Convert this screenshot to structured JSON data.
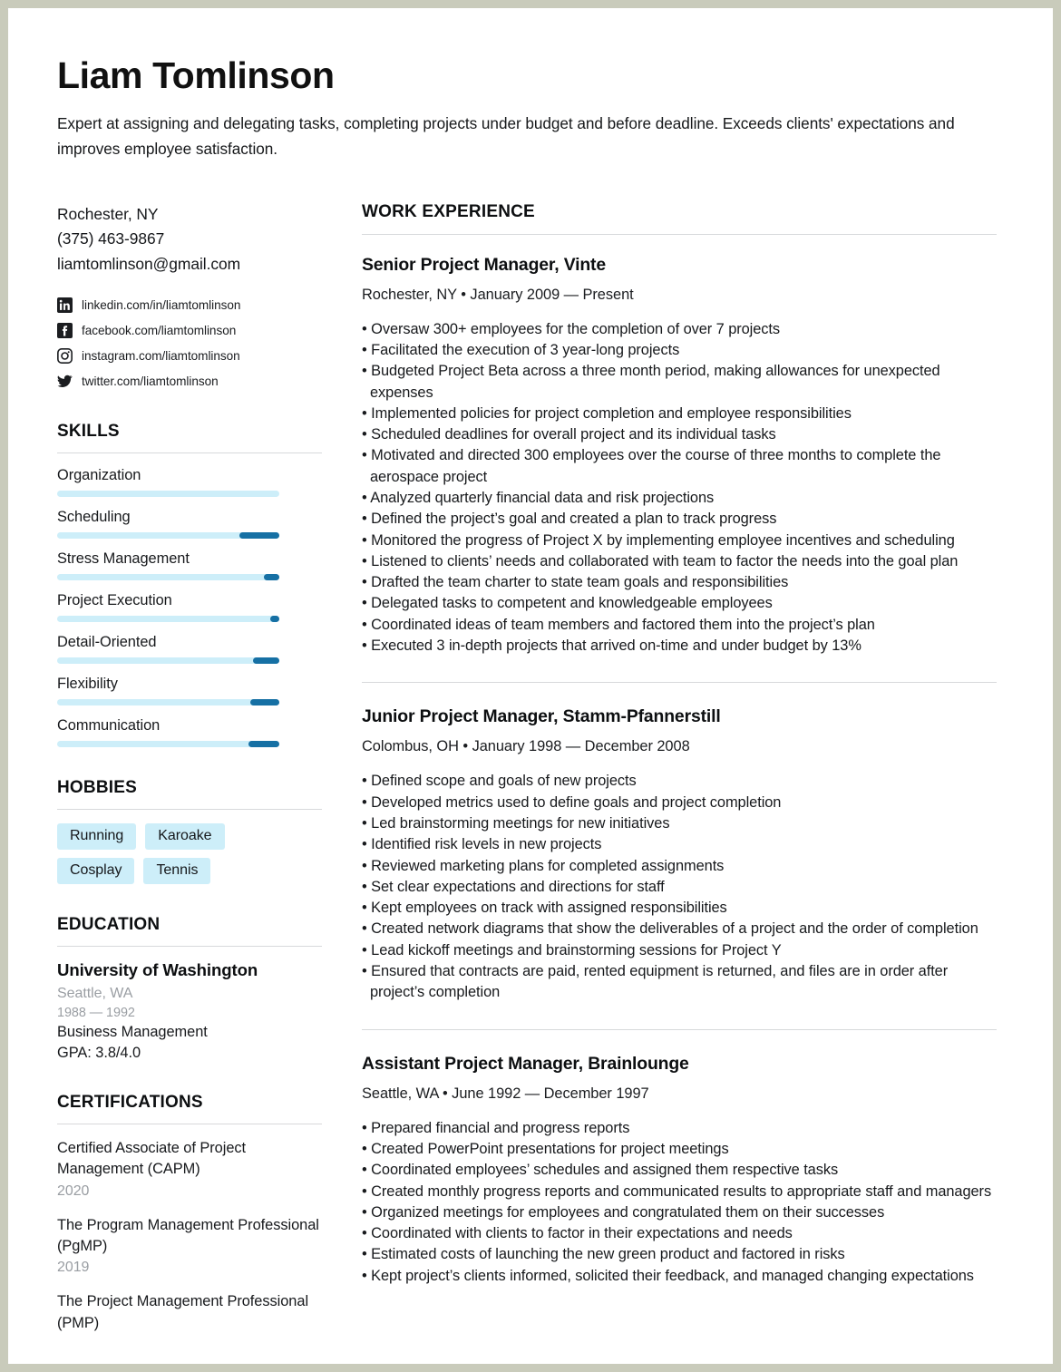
{
  "header": {
    "name": "Liam Tomlinson",
    "summary": "Expert at assigning and delegating tasks, completing projects under budget and before deadline. Exceeds clients' expectations and improves employee satisfaction."
  },
  "contact": {
    "location": "Rochester, NY",
    "phone": "(375) 463-9867",
    "email": "liamtomlinson@gmail.com",
    "social": [
      {
        "icon": "linkedin-icon",
        "text": "linkedin.com/in/liamtomlinson"
      },
      {
        "icon": "facebook-icon",
        "text": "facebook.com/liamtomlinson"
      },
      {
        "icon": "instagram-icon",
        "text": "instagram.com/liamtomlinson"
      },
      {
        "icon": "twitter-icon",
        "text": "twitter.com/liamtomlinson"
      }
    ]
  },
  "skills": {
    "heading": "SKILLS",
    "items": [
      {
        "name": "Organization",
        "fill_pct": 0
      },
      {
        "name": "Scheduling",
        "fill_pct": 18
      },
      {
        "name": "Stress Management",
        "fill_pct": 7
      },
      {
        "name": "Project Execution",
        "fill_pct": 4
      },
      {
        "name": "Detail-Oriented",
        "fill_pct": 12
      },
      {
        "name": "Flexibility",
        "fill_pct": 13
      },
      {
        "name": "Communication",
        "fill_pct": 14
      }
    ]
  },
  "hobbies": {
    "heading": "HOBBIES",
    "items": [
      "Running",
      "Karoake",
      "Cosplay",
      "Tennis"
    ]
  },
  "education": {
    "heading": "EDUCATION",
    "school": "University of Washington",
    "location": "Seattle, WA",
    "years": "1988 — 1992",
    "major": "Business Management",
    "gpa": "GPA: 3.8/4.0"
  },
  "certifications": {
    "heading": "CERTIFICATIONS",
    "items": [
      {
        "name": "Certified Associate of Project Management (CAPM)",
        "year": "2020"
      },
      {
        "name": "The Program Management Professional (PgMP)",
        "year": "2019"
      },
      {
        "name": "The Project Management Professional (PMP)",
        "year": ""
      }
    ]
  },
  "work": {
    "heading": "WORK EXPERIENCE",
    "jobs": [
      {
        "title": "Senior Project Manager, Vinte",
        "meta": "Rochester, NY • January 2009 — Present",
        "bullets": [
          "• Oversaw 300+ employees for the completion of over 7 projects",
          "• Facilitated the execution of 3 year-long projects",
          "• Budgeted Project Beta across a three month period, making allowances for unexpected expenses",
          "• Implemented policies for project completion and employee responsibilities",
          "• Scheduled deadlines for overall project and its individual tasks",
          "• Motivated and directed 300 employees over the course of three months to complete the aerospace project",
          "• Analyzed quarterly financial data and risk projections",
          "• Defined the project’s goal and created a plan to track progress",
          "• Monitored the progress of Project X by implementing employee incentives and scheduling",
          "• Listened to clients’ needs and collaborated with team to factor the needs into the goal plan",
          "• Drafted the team charter to state team goals and responsibilities",
          "• Delegated tasks to competent and knowledgeable employees",
          "• Coordinated ideas of team members and factored them into the project’s plan",
          "• Executed 3 in-depth projects that arrived on-time and under budget by 13%"
        ]
      },
      {
        "title": "Junior Project Manager, Stamm-Pfannerstill",
        "meta": "Colombus, OH • January 1998 — December 2008",
        "bullets": [
          "• Defined scope and goals of new projects",
          "• Developed metrics used to define goals and project completion",
          "• Led brainstorming meetings for new initiatives",
          "• Identified risk levels in new projects",
          "• Reviewed marketing plans for completed assignments",
          "• Set clear expectations and directions for staff",
          "• Kept employees on track with assigned responsibilities",
          "• Created network diagrams that show the deliverables of a project and the order of completion",
          "• Lead kickoff meetings and brainstorming sessions for Project Y",
          "• Ensured that contracts are paid, rented equipment is returned, and files are in order after project’s completion"
        ]
      },
      {
        "title": "Assistant Project Manager, Brainlounge",
        "meta": "Seattle, WA • June 1992 — December 1997",
        "bullets": [
          "• Prepared financial and progress reports",
          "• Created PowerPoint presentations for project meetings",
          "• Coordinated employees’ schedules and assigned them respective tasks",
          "• Created monthly progress reports and communicated results to appropriate staff and managers",
          "• Organized meetings for employees and congratulated them on their successes",
          "• Coordinated with clients to factor in their expectations and needs",
          "• Estimated costs of launching the new green product and factored in risks",
          "• Kept project’s clients informed, solicited their feedback, and managed changing expectations"
        ]
      }
    ]
  },
  "colors": {
    "accent_dark": "#1670a4",
    "accent_light": "#cdeef9",
    "page_border": "#c9cbbb",
    "muted_text": "#9a9ea3"
  }
}
